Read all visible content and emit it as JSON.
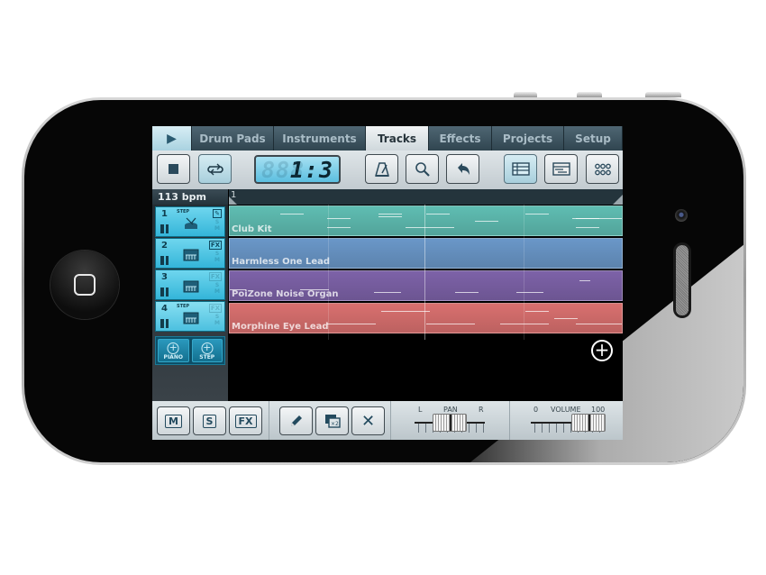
{
  "app": {
    "tabs": [
      {
        "label": "▶",
        "icon": "play-icon"
      },
      {
        "label": "Drum Pads"
      },
      {
        "label": "Instruments"
      },
      {
        "label": "Tracks",
        "active": true
      },
      {
        "label": "Effects"
      },
      {
        "label": "Projects"
      },
      {
        "label": "Setup"
      }
    ],
    "toolbar": {
      "stop": "stop-icon",
      "loop": "loop-icon",
      "lcd_display": "1:3",
      "lcd_ghost": "888",
      "metronome": "metronome-icon",
      "zoom": "magnifier-icon",
      "undo": "undo-icon",
      "view_tracks": "track-list-icon",
      "view_editor": "editor-view-icon",
      "view_grid": "grid-view-icon"
    },
    "tempo": "113 bpm",
    "ruler_start": "1",
    "tracks": [
      {
        "number": "1",
        "mode": "STEP",
        "instrument": "drum-icon",
        "badge": "edit",
        "name": "Club Kit",
        "color": "#5fbdb2"
      },
      {
        "number": "2",
        "mode": "",
        "instrument": "lead-keyboard-icon",
        "badge": "FX",
        "name": "Harmless One Lead",
        "color": "#6a97c8"
      },
      {
        "number": "3",
        "mode": "",
        "instrument": "lead-keyboard-icon",
        "badge": "",
        "name": "PoiZone Noise Organ",
        "color": "#7d62a8"
      },
      {
        "number": "4",
        "mode": "STEP",
        "instrument": "lead-keyboard-icon",
        "badge": "",
        "name": "Morphine Eye Lead",
        "color": "#d9706f"
      }
    ],
    "add_buttons": [
      {
        "label": "PIANO"
      },
      {
        "label": "STEP"
      }
    ],
    "add_track": "+",
    "bottom": {
      "mute": "M",
      "solo": "S",
      "fx": "FX",
      "pencil": "pencil-icon",
      "duplicate": "×2",
      "delete": "✕",
      "pan": {
        "label": "PAN",
        "left": "L",
        "right": "R",
        "value": 0.5
      },
      "volume": {
        "label": "VOLUME",
        "min": "0",
        "max": "100",
        "value": 80
      }
    }
  }
}
